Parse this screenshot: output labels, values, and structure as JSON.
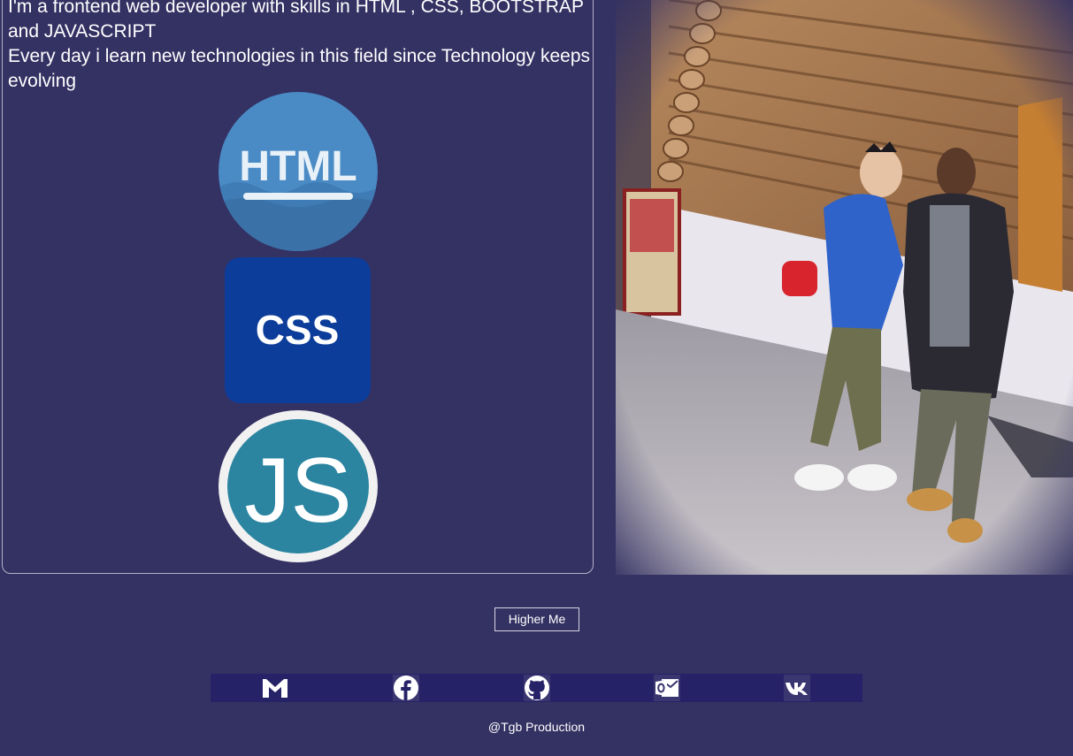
{
  "about": {
    "paragraph_1": "I'm a frontend web developer with skills in HTML , CSS, BOOTSTRAP and JAVASCRIPT",
    "paragraph_2": "Every day i learn new technologies in this field since Technology keeps evolving"
  },
  "skills": [
    {
      "label": "HTML",
      "icon": "html-logo-icon",
      "color": "#4a8bc5"
    },
    {
      "label": "CSS",
      "icon": "css-logo-icon",
      "color": "#0d3d9a"
    },
    {
      "label": "JS",
      "icon": "js-logo-icon",
      "color": "#2b85a0"
    }
  ],
  "hire_button": {
    "label": "Higher Me"
  },
  "social": [
    {
      "name": "gmail",
      "icon": "gmail-icon"
    },
    {
      "name": "facebook",
      "icon": "facebook-icon"
    },
    {
      "name": "github",
      "icon": "github-icon"
    },
    {
      "name": "outlook",
      "icon": "outlook-mail-icon"
    },
    {
      "name": "vk",
      "icon": "vk-icon"
    }
  ],
  "footer": {
    "credit": "@Tgb Production"
  },
  "colors": {
    "background": "#343163",
    "social_bar": "#262267",
    "text": "#ffffff"
  }
}
